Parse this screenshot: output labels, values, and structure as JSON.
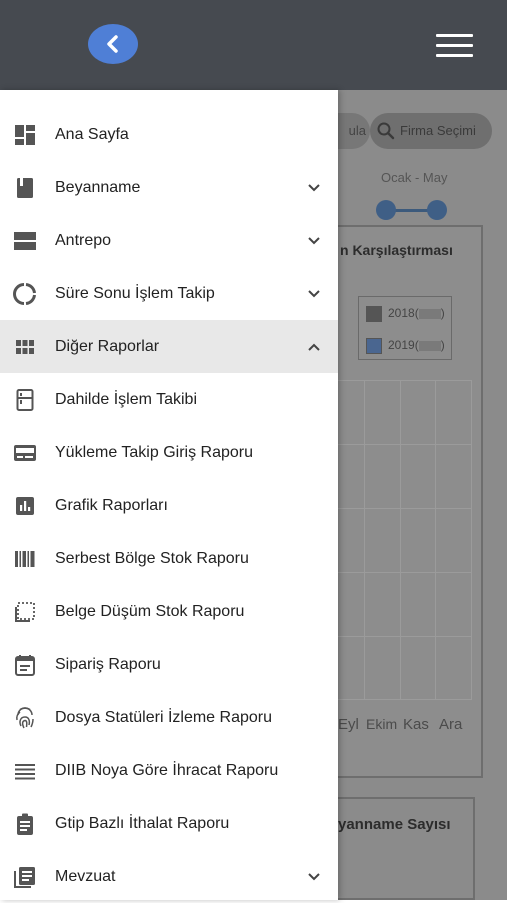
{
  "header": {
    "back_icon": "chevron-left-icon",
    "menu_icon": "hamburger-menu-icon",
    "accent_color": "#4f7fd6",
    "bar_color": "#464a50"
  },
  "background_page": {
    "left_chip_label": "ula",
    "firma_button_label": "Firma Seçimi",
    "period_label": "Ocak - May",
    "chart_title": "n Karşılaştırması",
    "legend": [
      {
        "label": "2018(",
        "suffix": ")",
        "color": "#555555"
      },
      {
        "label": "2019(",
        "suffix": ")",
        "color": "#4a6690"
      }
    ],
    "x_labels": [
      "Eyl",
      "Ekim",
      "Kas",
      "Ara"
    ],
    "second_card_title": "yanname Sayısı"
  },
  "menu": [
    {
      "label": "Ana Sayfa",
      "icon": "dashboard-icon",
      "chevron": ""
    },
    {
      "label": "Beyanname",
      "icon": "book-icon",
      "chevron": "down"
    },
    {
      "label": "Antrepo",
      "icon": "warehouse-icon",
      "chevron": "down"
    },
    {
      "label": "Süre Sonu İşlem Takip",
      "icon": "progress-circle-icon",
      "chevron": "down"
    },
    {
      "label": "Diğer Raporlar",
      "icon": "grid-icon",
      "chevron": "up",
      "active": true
    },
    {
      "label": "Dahilde İşlem Takibi",
      "icon": "fridge-icon",
      "chevron": ""
    },
    {
      "label": "Yükleme Takip Giriş Raporu",
      "icon": "card-icon",
      "chevron": ""
    },
    {
      "label": "Grafik Raporları",
      "icon": "bar-chart-icon",
      "chevron": ""
    },
    {
      "label": "Serbest Bölge Stok Raporu",
      "icon": "barcode-icon",
      "chevron": ""
    },
    {
      "label": "Belge Düşüm Stok Raporu",
      "icon": "dotted-select-icon",
      "chevron": ""
    },
    {
      "label": "Sipariş Raporu",
      "icon": "calendar-icon",
      "chevron": ""
    },
    {
      "label": "Dosya Statüleri İzleme Raporu",
      "icon": "fingerprint-icon",
      "chevron": ""
    },
    {
      "label": "DIIB Noya Göre İhracat Raporu",
      "icon": "list-lines-icon",
      "chevron": ""
    },
    {
      "label": "Gtip Bazlı İthalat Raporu",
      "icon": "clipboard-icon",
      "chevron": ""
    },
    {
      "label": "Mevzuat",
      "icon": "document-list-icon",
      "chevron": "down"
    }
  ]
}
